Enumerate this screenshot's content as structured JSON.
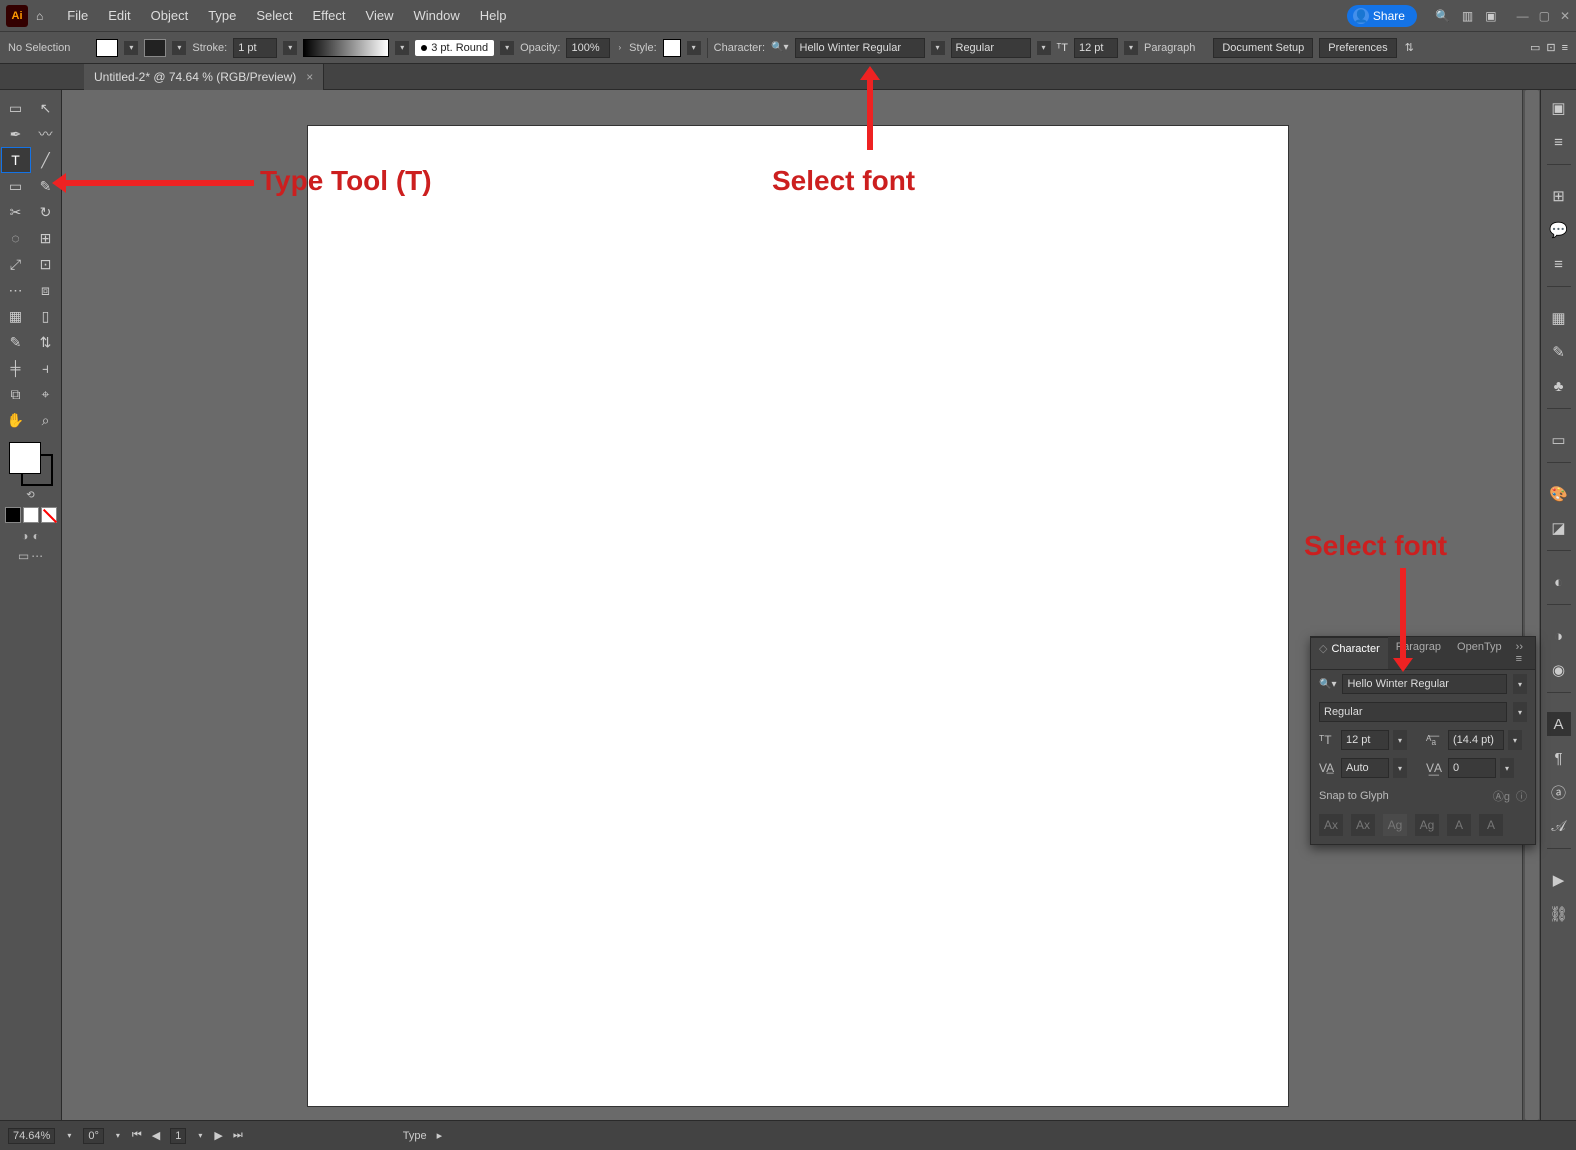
{
  "menubar": {
    "logo": "Ai",
    "items": [
      "File",
      "Edit",
      "Object",
      "Type",
      "Select",
      "Effect",
      "View",
      "Window",
      "Help"
    ],
    "share": "Share"
  },
  "controlbar": {
    "noselection": "No Selection",
    "stroke_label": "Stroke:",
    "stroke_val": "1 pt",
    "brush_profile": "3 pt. Round",
    "opacity_label": "Opacity:",
    "opacity_val": "100%",
    "style_label": "Style:",
    "character_label": "Character:",
    "font_family": "Hello Winter Regular",
    "font_style": "Regular",
    "font_size": "12 pt",
    "paragraph_label": "Paragraph",
    "doc_setup": "Document Setup",
    "prefs": "Preferences"
  },
  "doctab": {
    "title": "Untitled-2* @ 74.64 % (RGB/Preview)"
  },
  "tools": [
    "▭",
    "↖",
    "✒",
    "〰",
    "T",
    "╱",
    "▭",
    "✎",
    "✂",
    "↻",
    "◌",
    "⊞",
    "⤢",
    "⊡",
    "⋯",
    "⧈",
    "▦",
    "▯",
    "✎",
    "⇅",
    "╪",
    "⫞",
    "⧉",
    "⌖",
    "✋",
    "⌕"
  ],
  "selected_tool_index": 4,
  "char_panel": {
    "tabs": [
      "Character",
      "Paragrap",
      "OpenTyp"
    ],
    "font_family": "Hello Winter Regular",
    "font_style": "Regular",
    "size": "12 pt",
    "leading": "(14.4 pt)",
    "kerning": "Auto",
    "tracking": "0",
    "snap": "Snap to Glyph",
    "glyphs": [
      "Ax",
      "Ax",
      "Ag",
      "Ag",
      "A",
      "A"
    ]
  },
  "statusbar": {
    "zoom": "74.64%",
    "rotate": "0°",
    "artboard": "1",
    "tool": "Type"
  },
  "annotations": {
    "type_tool": "Type Tool (T)",
    "select_font_top": "Select font",
    "select_font_panel": "Select font"
  }
}
